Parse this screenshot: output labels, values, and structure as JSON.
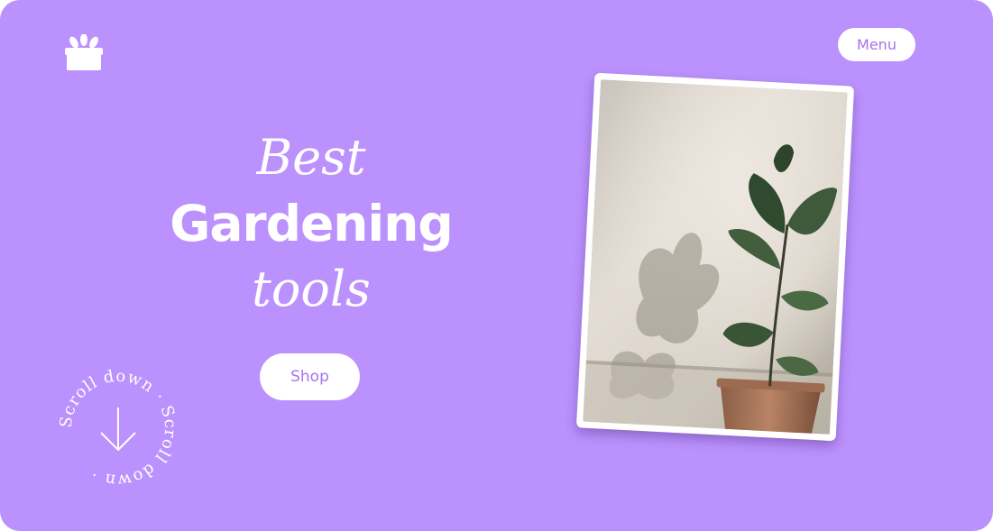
{
  "header": {
    "logo_icon": "gift-box-icon",
    "menu_label": "Menu"
  },
  "hero": {
    "title_line1": "Best",
    "title_line2": "Gardening",
    "title_line3": "tools",
    "cta_label": "Shop"
  },
  "scroll_badge": {
    "ring_text": "Scroll down · Scroll down ·",
    "icon": "arrow-down-icon"
  },
  "photo": {
    "subject": "potted-plant-photo"
  },
  "colors": {
    "background": "#bb91fd",
    "accent_text": "#a873ef",
    "white": "#ffffff"
  }
}
